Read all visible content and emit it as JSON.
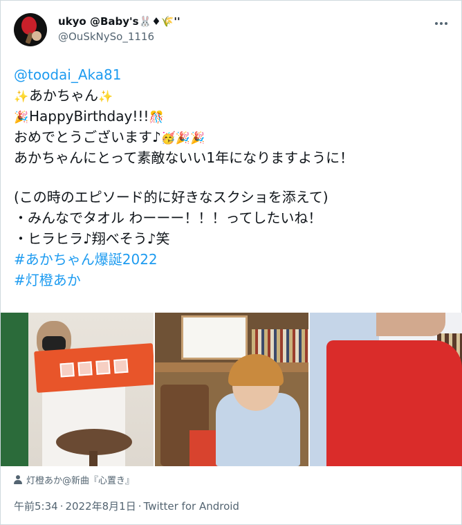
{
  "author": {
    "display_name": "ukyo @Baby's",
    "display_name_emoji": "🐰♦🌾''",
    "handle": "@OuSkNySo_1116"
  },
  "tweet": {
    "mention": "@toodai_Aka81",
    "line2_emoji_left": "✨",
    "line2_text": "あかちゃん",
    "line2_emoji_right": "✨",
    "line3_emoji_left": "🎉",
    "line3_text": "HappyBirthday!!!",
    "line3_emoji_right": "🎊",
    "line4_text": "おめでとうございます♪",
    "line4_emoji": "🥳🎉🎉",
    "line5_text": "あかちゃんにとって素敵ないい1年になりますように！",
    "line6_text": "(この時のエピソード的に好きなスクショを添えて)",
    "line7_text": "・みんなでタオル わーーー！！！ってしたいね！",
    "line8_text": "・ヒラヒラ♪翔べそう♪笑",
    "hashtag1": "#あかちゃん爆誕2022",
    "hashtag2": "#灯橙あか"
  },
  "media": {
    "photo_count": 3,
    "tagged_user": "灯橙あか@新曲『心置き』"
  },
  "meta": {
    "time": "午前5:34",
    "date": "2022年8月1日",
    "separator": "·",
    "source": "Twitter for Android"
  },
  "colors": {
    "text": "#0f1419",
    "secondary": "#536471",
    "link": "#1d9bf0",
    "border": "#cfd9de"
  }
}
